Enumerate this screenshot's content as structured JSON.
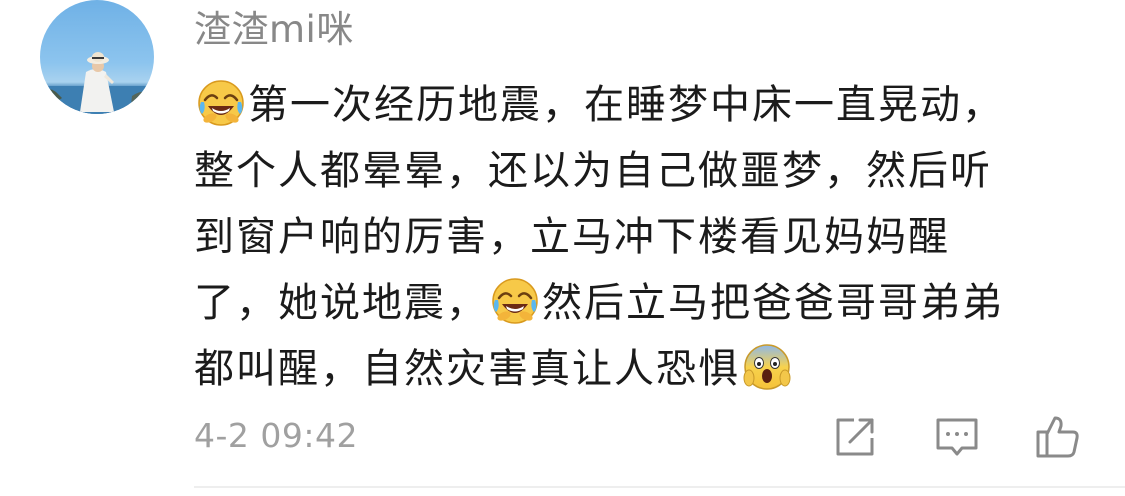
{
  "comment": {
    "username": "渣渣mi咪",
    "avatar_icon": "avatar-photo",
    "body": {
      "line1": {
        "text": "第一次经历地震，在睡梦中床一直晃动，",
        "lead_emoji": "face-with-tears-of-joy"
      },
      "line2": {
        "text": "整个人都晕晕，还以为自己做噩梦，然后听"
      },
      "line3": {
        "text": "到窗户响的厉害，立马冲下楼看见妈妈醒"
      },
      "line4": {
        "part1": "了，她说地震，",
        "emoji": "face-with-tears-of-joy",
        "part2": "然后立马把爸爸哥哥弟弟"
      },
      "line5": {
        "text": "都叫醒，自然灾害真让人恐惧",
        "trail_emoji": "face-screaming-in-fear"
      }
    },
    "timestamp": "4-2 09:42",
    "actions": {
      "share_icon": "share-icon",
      "reply_icon": "reply-icon",
      "like_icon": "thumbs-up-icon"
    },
    "colors": {
      "username": "#888888",
      "body_text": "#1b1b1b",
      "meta_text": "#a0a0a0",
      "icon_stroke": "#8a8a8a"
    }
  }
}
